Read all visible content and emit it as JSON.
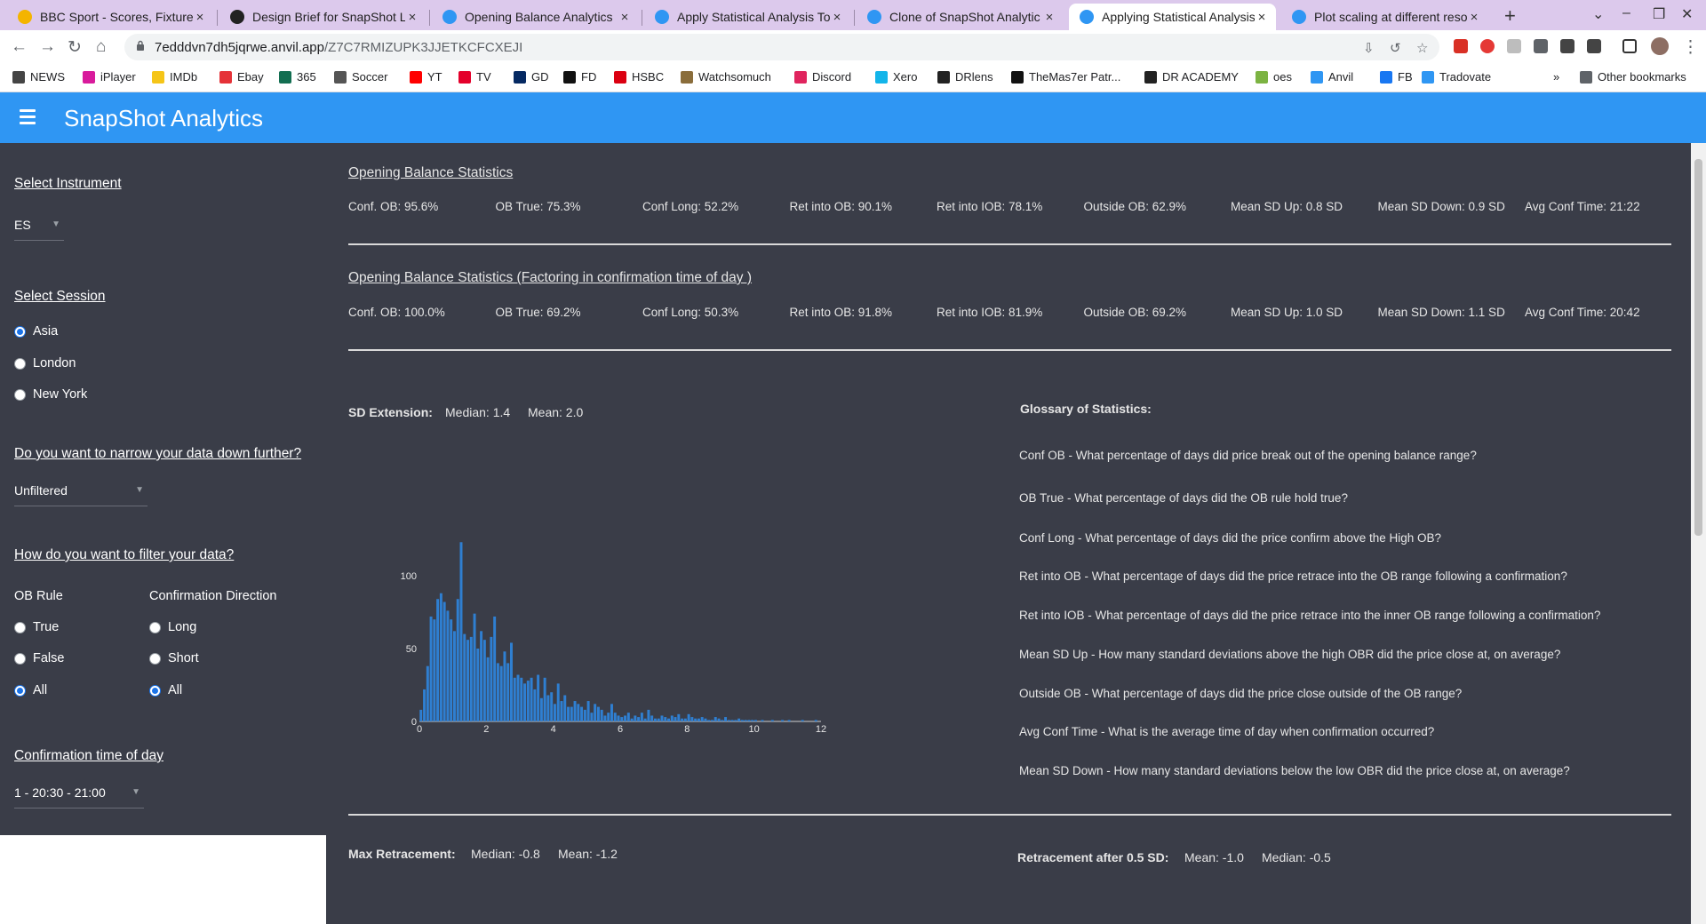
{
  "browser": {
    "tabs": [
      {
        "title": "BBC Sport - Scores, Fixture",
        "color": "#f4b400",
        "active": false
      },
      {
        "title": "Design Brief for SnapShot L",
        "color": "#222222",
        "active": false
      },
      {
        "title": "Opening Balance Analytics",
        "color": "#2f96f3",
        "active": false
      },
      {
        "title": "Apply Statistical Analysis To",
        "color": "#2f96f3",
        "active": false
      },
      {
        "title": "Clone of SnapShot Analytic",
        "color": "#2f96f3",
        "active": false
      },
      {
        "title": "Applying Statistical Analysis",
        "color": "#2f96f3",
        "active": true
      },
      {
        "title": "Plot scaling at different reso",
        "color": "#2f96f3",
        "active": false
      }
    ],
    "url_host": "7edddvn7dh5jqrwe.anvil.app",
    "url_path": "/Z7C7RMIZUPK3JJETKCFCXEJI",
    "bookmarks": [
      {
        "label": "NEWS",
        "color": "#444444"
      },
      {
        "label": "iPlayer",
        "color": "#d81b9c"
      },
      {
        "label": "IMDb",
        "color": "#f5c518"
      },
      {
        "label": "Ebay",
        "color": "#e53238"
      },
      {
        "label": "365",
        "color": "#126e51"
      },
      {
        "label": "Soccer",
        "color": "#555555"
      },
      {
        "label": "YT",
        "color": "#ff0000"
      },
      {
        "label": "TV",
        "color": "#e4002b"
      },
      {
        "label": "GD",
        "color": "#052962"
      },
      {
        "label": "FD",
        "color": "#111111"
      },
      {
        "label": "HSBC",
        "color": "#db0011"
      },
      {
        "label": "Watchsomuch",
        "color": "#8a6d3b"
      },
      {
        "label": "Discord",
        "color": "#e0245e"
      },
      {
        "label": "Xero",
        "color": "#13b5ea"
      },
      {
        "label": "DRlens",
        "color": "#222222"
      },
      {
        "label": "TheMas7er Patr...",
        "color": "#111111"
      },
      {
        "label": "DR ACADEMY",
        "color": "#222222"
      },
      {
        "label": "oes",
        "color": "#7cb342"
      },
      {
        "label": "Anvil",
        "color": "#2f96f3"
      },
      {
        "label": "FB",
        "color": "#1877f2"
      },
      {
        "label": "Tradovate",
        "color": "#2f96f3"
      }
    ],
    "other_bookmarks": "Other bookmarks"
  },
  "app": {
    "title": "SnapShot Analytics",
    "accent": "#2f96f3"
  },
  "sidebar": {
    "instrument_heading": "Select Instrument",
    "instrument_value": "ES",
    "session_heading": "Select Session",
    "sessions": [
      "Asia",
      "London",
      "New York"
    ],
    "selected_session": "Asia",
    "narrow_heading": "Do you want to narrow your data down further?",
    "narrow_value": "Unfiltered",
    "filter_heading": "How do you want to filter your data?",
    "ob_rule_label": "OB Rule",
    "ob_rule_options": [
      "True",
      "False",
      "All"
    ],
    "ob_rule_selected": "All",
    "direction_label": "Confirmation Direction",
    "direction_options": [
      "Long",
      "Short",
      "All"
    ],
    "direction_selected": "All",
    "conf_time_heading": "Confirmation time of day",
    "conf_time_value": "1 - 20:30 - 21:00"
  },
  "stats1": {
    "title": "Opening Balance Statistics",
    "items": [
      "Conf. OB: 95.6%",
      "OB True: 75.3%",
      "Conf Long: 52.2%",
      "Ret into OB: 90.1%",
      "Ret into IOB: 78.1%",
      "Outside OB: 62.9%",
      "Mean SD Up: 0.8 SD",
      "Mean SD Down: 0.9 SD",
      "Avg Conf Time: 21:22"
    ]
  },
  "stats2": {
    "title": "Opening Balance Statistics (Factoring in confirmation time of day )",
    "items": [
      "Conf. OB: 100.0%",
      "OB True: 69.2%",
      "Conf Long: 50.3%",
      "Ret into OB: 91.8%",
      "Ret into IOB: 81.9%",
      "Outside OB: 69.2%",
      "Mean SD Up: 1.0 SD",
      "Mean SD Down: 1.1 SD",
      "Avg Conf Time: 20:42"
    ]
  },
  "sd_extension": {
    "label": "SD Extension:",
    "median": "Median: 1.4",
    "mean": "Mean: 2.0"
  },
  "glossary": {
    "title": "Glossary of Statistics:",
    "items": [
      "Conf OB - What percentage of days did price break out of the opening balance range?",
      "OB True - What percentage of days did the OB rule hold true?",
      "Conf Long - What percentage of days did the price confirm above the High OB?",
      "Ret into OB - What percentage of days did the price retrace into the OB range following a confirmation?",
      "Ret into IOB - What percentage of days did the price retrace into the inner OB range following a confirmation?",
      "Mean SD Up - How many standard deviations above the high OBR did the price close at, on average?",
      "Outside OB - What percentage of days did the price close outside of the OB range?",
      "Avg Conf Time - What is the average time of day when confirmation occurred?",
      "Mean SD Down - How many standard deviations below the low OBR did the price close at, on average?"
    ]
  },
  "max_retracement": {
    "label": "Max Retracement:",
    "median": "Median: -0.8",
    "mean": "Mean: -1.2"
  },
  "retracement_05": {
    "label": "Retracement after 0.5 SD:",
    "mean": "Mean: -1.0",
    "median": "Median: -0.5"
  },
  "chart_data": {
    "type": "bar",
    "title": "",
    "xlabel": "",
    "ylabel": "",
    "xlim": [
      0,
      12
    ],
    "ylim": [
      0,
      125
    ],
    "xticks": [
      0,
      2,
      4,
      6,
      8,
      10,
      12
    ],
    "yticks": [
      0,
      50,
      100
    ],
    "bar_color": "#2f7fd1",
    "bin_width": 0.1,
    "x": [
      0.0,
      0.1,
      0.2,
      0.3,
      0.4,
      0.5,
      0.6,
      0.7,
      0.8,
      0.9,
      1.0,
      1.1,
      1.2,
      1.3,
      1.4,
      1.5,
      1.6,
      1.7,
      1.8,
      1.9,
      2.0,
      2.1,
      2.2,
      2.3,
      2.4,
      2.5,
      2.6,
      2.7,
      2.8,
      2.9,
      3.0,
      3.1,
      3.2,
      3.3,
      3.4,
      3.5,
      3.6,
      3.7,
      3.8,
      3.9,
      4.0,
      4.1,
      4.2,
      4.3,
      4.4,
      4.5,
      4.6,
      4.7,
      4.8,
      4.9,
      5.0,
      5.1,
      5.2,
      5.3,
      5.4,
      5.5,
      5.6,
      5.7,
      5.8,
      5.9,
      6.0,
      6.1,
      6.2,
      6.3,
      6.4,
      6.5,
      6.6,
      6.7,
      6.8,
      6.9,
      7.0,
      7.1,
      7.2,
      7.3,
      7.4,
      7.5,
      7.6,
      7.7,
      7.8,
      7.9,
      8.0,
      8.1,
      8.2,
      8.3,
      8.4,
      8.5,
      8.6,
      8.7,
      8.8,
      8.9,
      9.0,
      9.1,
      9.2,
      9.3,
      9.4,
      9.5,
      9.6,
      9.7,
      9.8,
      9.9,
      10.0,
      10.2,
      10.5,
      10.8,
      11.0,
      11.4,
      11.8
    ],
    "values": [
      8,
      22,
      38,
      72,
      70,
      84,
      88,
      82,
      76,
      70,
      62,
      84,
      123,
      60,
      56,
      58,
      74,
      50,
      62,
      56,
      44,
      58,
      72,
      40,
      38,
      48,
      40,
      54,
      30,
      32,
      30,
      26,
      28,
      30,
      22,
      32,
      16,
      30,
      18,
      20,
      12,
      26,
      14,
      18,
      10,
      10,
      14,
      12,
      10,
      8,
      14,
      6,
      12,
      10,
      8,
      4,
      6,
      12,
      6,
      4,
      3,
      4,
      6,
      2,
      4,
      3,
      6,
      2,
      8,
      4,
      2,
      2,
      4,
      3,
      2,
      4,
      3,
      5,
      2,
      2,
      5,
      3,
      2,
      2,
      3,
      2,
      1,
      1,
      3,
      2,
      1,
      3,
      1,
      1,
      1,
      2,
      1,
      1,
      1,
      1,
      1,
      1,
      1,
      1,
      1,
      1,
      1
    ]
  }
}
